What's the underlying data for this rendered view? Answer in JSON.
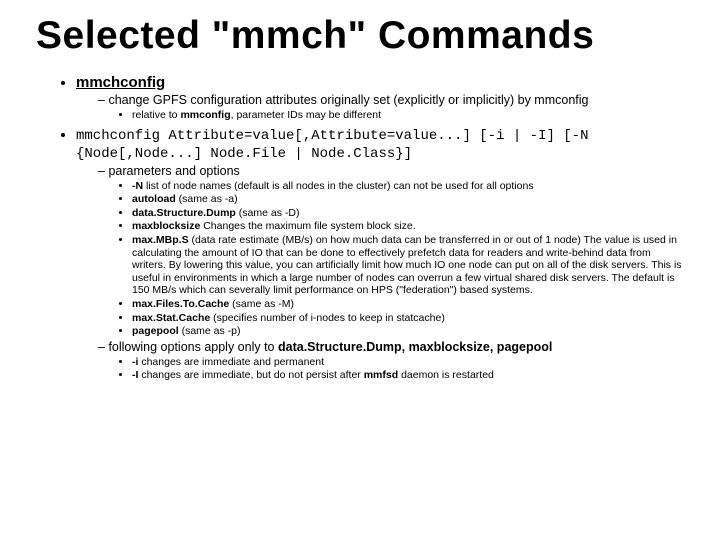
{
  "title": "Selected \"mmch\" Commands",
  "items": [
    {
      "cmd": "mmchconfig",
      "dash": [
        {
          "text": "change GPFS configuration attributes originally set (explicitly or implicitly) by mmconfig",
          "sub": [
            {
              "html": "relative to <b>mmconfig</b>, parameter IDs may be different"
            }
          ]
        }
      ]
    },
    {
      "cmd_mono": "mmchconfig Attribute=value[,Attribute=value...]  [-i | -I] [-N {Node[,Node...] Node.File | Node.Class}]",
      "dash": [
        {
          "text": "parameters and options",
          "sub": [
            {
              "html": "<b>-N</b> list of node names (default is all nodes in the cluster) can not be used for all options"
            },
            {
              "html": "<b>autoload</b> (same as -a)"
            },
            {
              "html": "<b>data.Structure.Dump</b> (same as -D)"
            },
            {
              "html": "<b>maxblocksize</b> Changes the maximum file system block size."
            },
            {
              "html": "<b>max.MBp.S</b> (data rate estimate (MB/s) on how much data can be transferred in or out of 1 node) The value is used in calculating the amount of IO that can be done to effectively prefetch data for readers and write-behind data from writers. By lowering this value, you can artificially limit how much IO one node can put on all of the disk servers. This is useful in environments in which a large number of nodes can overrun a few virtual shared disk servers. The default is 150 MB/s which can severally limit performance on HPS (\"federation\") based systems."
            },
            {
              "html": "<b>max.Files.To.Cache</b> (same as -M)"
            },
            {
              "html": "<b>max.Stat.Cache</b> (specifies number of i-nodes to keep in statcache)"
            },
            {
              "html": "<b>pagepool</b> (same as -p)"
            }
          ]
        },
        {
          "html": "following options apply only to <b>data.Structure.Dump, maxblocksize, pagepool</b>",
          "sub": [
            {
              "html": "<b>-i</b> changes are immediate and permanent"
            },
            {
              "html": "<b>-I</b> changes are immediate, but do not persist after <b>mmfsd</b> daemon is restarted"
            }
          ]
        }
      ]
    }
  ]
}
